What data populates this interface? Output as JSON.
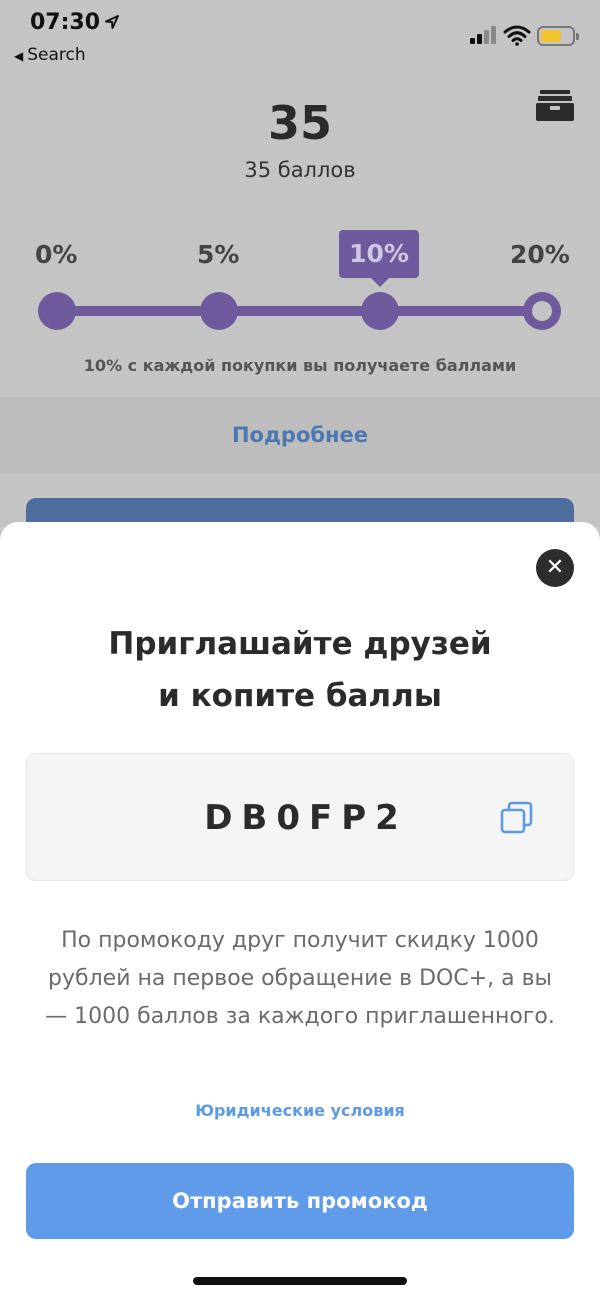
{
  "status_bar": {
    "time": "07:30",
    "back_label": "Search"
  },
  "header": {
    "points_value": "35",
    "points_label": "35 баллов"
  },
  "levels": {
    "items": [
      "0%",
      "5%",
      "10%",
      "20%"
    ],
    "active": "10%",
    "hint": "10% с каждой покупки вы получаете баллами"
  },
  "more_link": "Подробнее",
  "sheet": {
    "title_line1": "Приглашайте друзей",
    "title_line2": "и копите баллы",
    "promo_code": "DB0FP2",
    "description": "По промокоду друг получит скидку 1000 рублей на первое обращение в DOC+, а вы — 1000 баллов за каждого приглашенного.",
    "legal_link": "Юридические условия",
    "send_button": "Отправить промокод"
  },
  "colors": {
    "accent_purple": "#6f5a9e",
    "accent_blue": "#5f9be8",
    "link_blue": "#5d9ae6",
    "battery": "#f2c230"
  },
  "icons": [
    "location-arrow-icon",
    "signal-icon",
    "wifi-icon",
    "battery-icon",
    "archive-box-icon",
    "close-icon",
    "copy-icon"
  ]
}
